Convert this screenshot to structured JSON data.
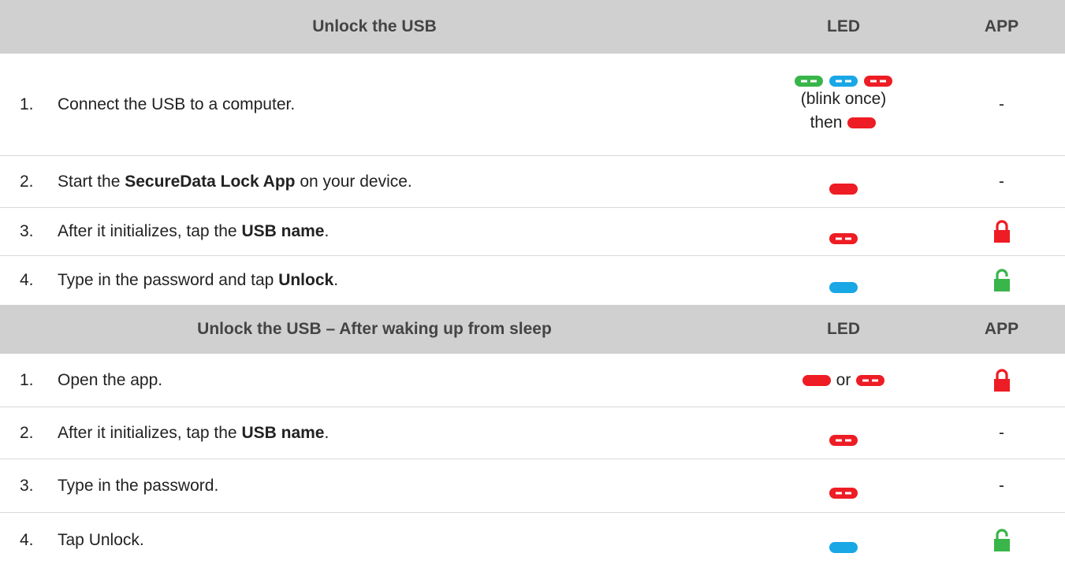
{
  "colors": {
    "red": "#ee1c24",
    "blue": "#19a7e6",
    "green": "#39b54a",
    "header_bg": "#d0d0d0"
  },
  "section1": {
    "title": "Unlock the USB",
    "led_header": "LED",
    "app_header": "APP",
    "rows": [
      {
        "num": "1.",
        "text": "Connect the USB to a computer.",
        "led_note": "(blink once)",
        "led_then": "then",
        "app": "-"
      },
      {
        "num": "2.",
        "pre": "Start the ",
        "bold": "SecureData Lock App",
        "post": " on your device.",
        "app": "-"
      },
      {
        "num": "3.",
        "pre": "After it initializes, tap the ",
        "bold": "USB name",
        "post": ".",
        "app_icon": "red-lock-icon"
      },
      {
        "num": "4.",
        "pre": "Type in the password and tap ",
        "bold": "Unlock",
        "post": ".",
        "app_icon": "green-unlock-icon"
      }
    ]
  },
  "section2": {
    "title": "Unlock the USB – After waking up from sleep",
    "led_header": "LED",
    "app_header": "APP",
    "rows": [
      {
        "num": "1.",
        "text": "Open the app.",
        "led_or": "or",
        "app_icon": "red-lock-icon"
      },
      {
        "num": "2.",
        "pre": "After it initializes, tap the ",
        "bold": "USB name",
        "post": ".",
        "app": "-"
      },
      {
        "num": "3.",
        "text": "Type in the password.",
        "app": "-"
      },
      {
        "num": "4.",
        "text": "Tap Unlock.",
        "app_icon": "green-unlock-icon"
      }
    ]
  }
}
